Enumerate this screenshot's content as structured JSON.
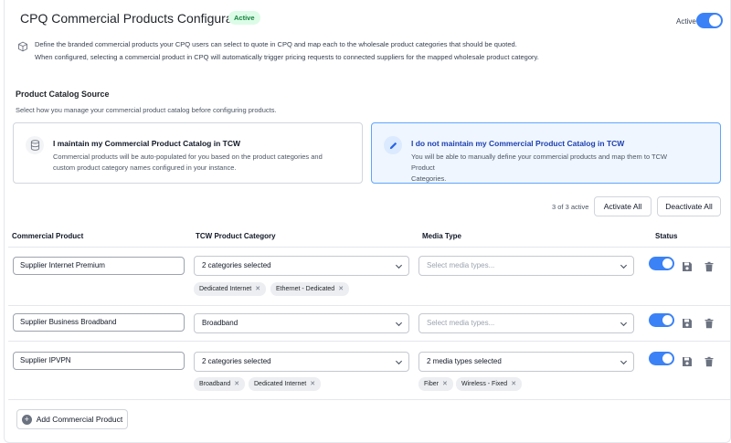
{
  "header": {
    "title": "CPQ Commercial Products Configuration",
    "badge": "Active",
    "active_label": "Active",
    "active_on": true
  },
  "intro": {
    "line1": "Define the branded commercial products your CPQ users can select to quote in CPQ and map each to the wholesale product categories that should be quoted.",
    "line2": "When configured, selecting a commercial product in CPQ will automatically trigger pricing requests to connected suppliers for the mapped wholesale product category."
  },
  "catalog": {
    "title": "Product Catalog Source",
    "subtitle": "Select how you manage your commercial product catalog before configuring products.",
    "options": [
      {
        "title": "I maintain my Commercial Product Catalog in TCW",
        "desc_line1": "Commercial products will be auto-populated for you based on the product categories and",
        "desc_line2": "custom product category names configured in your instance.",
        "icon": "database-icon",
        "selected": false
      },
      {
        "title": "I do not maintain my Commercial Product Catalog in TCW",
        "desc_line1": "You will be able to manually define your commercial products and map them to TCW Product",
        "desc_line2": "Categories.",
        "icon": "pencil-icon",
        "selected": true
      }
    ]
  },
  "toolbar": {
    "count": "3 of 3 active",
    "activate_all": "Activate All",
    "deactivate_all": "Deactivate All"
  },
  "table": {
    "columns": [
      "Commercial Product",
      "TCW Product Category",
      "Media Type",
      "Status"
    ],
    "rows": [
      {
        "product": "Supplier Internet Premium",
        "category": "2 categories selected",
        "category_chips": [
          "Dedicated Internet",
          "Ethernet - Dedicated"
        ],
        "media": "Select media types...",
        "media_placeholder": true,
        "media_chips": [],
        "active": true
      },
      {
        "product": "Supplier Business Broadband",
        "category": "Broadband",
        "category_chips": [],
        "media": "Select media types...",
        "media_placeholder": true,
        "media_chips": [],
        "active": true
      },
      {
        "product": "Supplier IPVPN",
        "category": "2 categories selected",
        "category_chips": [
          "Broadband",
          "Dedicated Internet"
        ],
        "media": "2 media types selected",
        "media_placeholder": false,
        "media_chips": [
          "Fiber",
          "Wireless - Fixed"
        ],
        "active": true
      }
    ]
  },
  "add_button": "Add Commercial Product",
  "colors": {
    "accent": "#3b82f6",
    "badge_bg": "#dcfce7",
    "badge_text": "#15803d",
    "selected_card_bg": "#eff6ff"
  }
}
